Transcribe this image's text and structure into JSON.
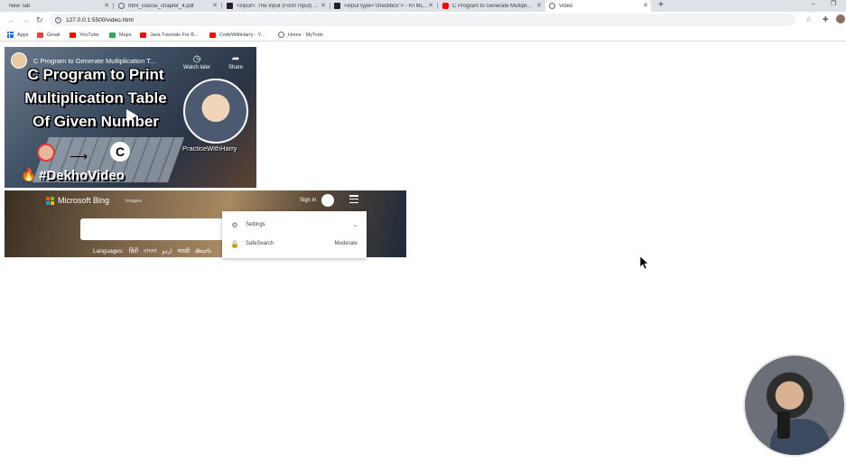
{
  "browser": {
    "tabs": [
      {
        "title": "New Tab",
        "favicon_color": "#dee1e6",
        "active": false
      },
      {
        "title": "html_course_chapter_4.pdf",
        "favicon_color": "#5f6368",
        "active": false
      },
      {
        "title": "<input>: The Input (Form Input) ...",
        "favicon_color": "#202124",
        "active": false
      },
      {
        "title": "<input type=\"checkbox\"> - HTML...",
        "favicon_color": "#202124",
        "active": false
      },
      {
        "title": "C Program to Generate Multipli...",
        "favicon_color": "#ff0000",
        "active": false
      },
      {
        "title": "Video",
        "favicon_color": "#5f6368",
        "active": true
      }
    ],
    "new_tab_symbol": "+",
    "window_controls": {
      "minimize": "–",
      "restore": "❐"
    },
    "url": "127.0.0.1:5500/video.html",
    "toolbar_icons": [
      "back-icon",
      "forward-icon",
      "reload-icon",
      "bookmark-star-icon",
      "extensions-icon",
      "menu-dots-icon"
    ],
    "bookmarks": [
      {
        "label": "Apps",
        "icon": "apps-grid-icon",
        "color": "#1a73e8"
      },
      {
        "label": "Gmail",
        "icon": "gmail-icon",
        "color": "#ea4335"
      },
      {
        "label": "YouTube",
        "icon": "youtube-icon",
        "color": "#ff0000"
      },
      {
        "label": "Maps",
        "icon": "maps-icon",
        "color": "#34a853"
      },
      {
        "label": "Java Tutorials For B...",
        "icon": "youtube-icon",
        "color": "#ff0000"
      },
      {
        "label": "CodeWithHarry - Y...",
        "icon": "youtube-icon",
        "color": "#ff0000"
      },
      {
        "label": "Home - MyTodo",
        "icon": "globe-icon",
        "color": "#5f6368"
      }
    ]
  },
  "video": {
    "top_title": "C Program to Generate Multiplication T...",
    "big_title_lines": [
      "C Program to Print",
      "Multiplication Table",
      "Of Given Number"
    ],
    "watch_later": "Watch later",
    "share": "Share",
    "host_label": "PracticeWithHarry",
    "logo_letter": "C",
    "hashtag": "#DekhoVideo"
  },
  "bing": {
    "brand": "Microsoft Bing",
    "images_link": "Images",
    "sign_in": "Sign in",
    "languages_label": "Languages:",
    "languages": [
      "हिंदी",
      "বাংলা",
      "اردو",
      "मराठी",
      "తెలుగు"
    ],
    "dropdown": {
      "settings_label": "Settings",
      "safesearch_label": "SafeSearch",
      "safesearch_value": "Moderate"
    }
  }
}
